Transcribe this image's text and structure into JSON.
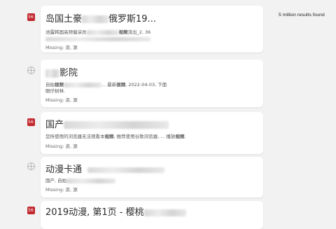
{
  "results_count": "5 million results found",
  "results": [
    {
      "icon": "red-square-favicon",
      "title_a": "岛国土豪",
      "title_b": "俄罗斯19...",
      "snippet_a": "池露韩国高频偏演员",
      "snippet_b": "视频",
      "snippet_c": "流出_2, 36",
      "missing": "Missing: 资, 源"
    },
    {
      "icon": "globe-icon",
      "title_b": "影院",
      "snippet_a": "自拍",
      "snippet_a2": "视频",
      "snippet_b": "... 最新",
      "snippet_b2": "视频",
      "snippet_c": ", 2022-04-03, 下面",
      "snippet_line2": "眼仔树林.",
      "missing": "Missing: 资, 源"
    },
    {
      "icon": "red-square-favicon",
      "title_a": "国产",
      "snippet_a": "您所使用的浏览器无法观看本",
      "snippet_a2": "视频",
      "snippet_b": ", 推荐使用谷歌浏览器, ... 播放",
      "snippet_b2": "视频",
      "snippet_c": ".",
      "missing": "Missing: 资, 源"
    },
    {
      "icon": "globe-icon",
      "title_a": "动漫卡通",
      "snippet_a": "国产, 自拍",
      "missing": "Missing: 资, 源"
    },
    {
      "icon": "red-square-favicon",
      "title_a": "2019动漫, 第1页 - 樱桃"
    }
  ]
}
